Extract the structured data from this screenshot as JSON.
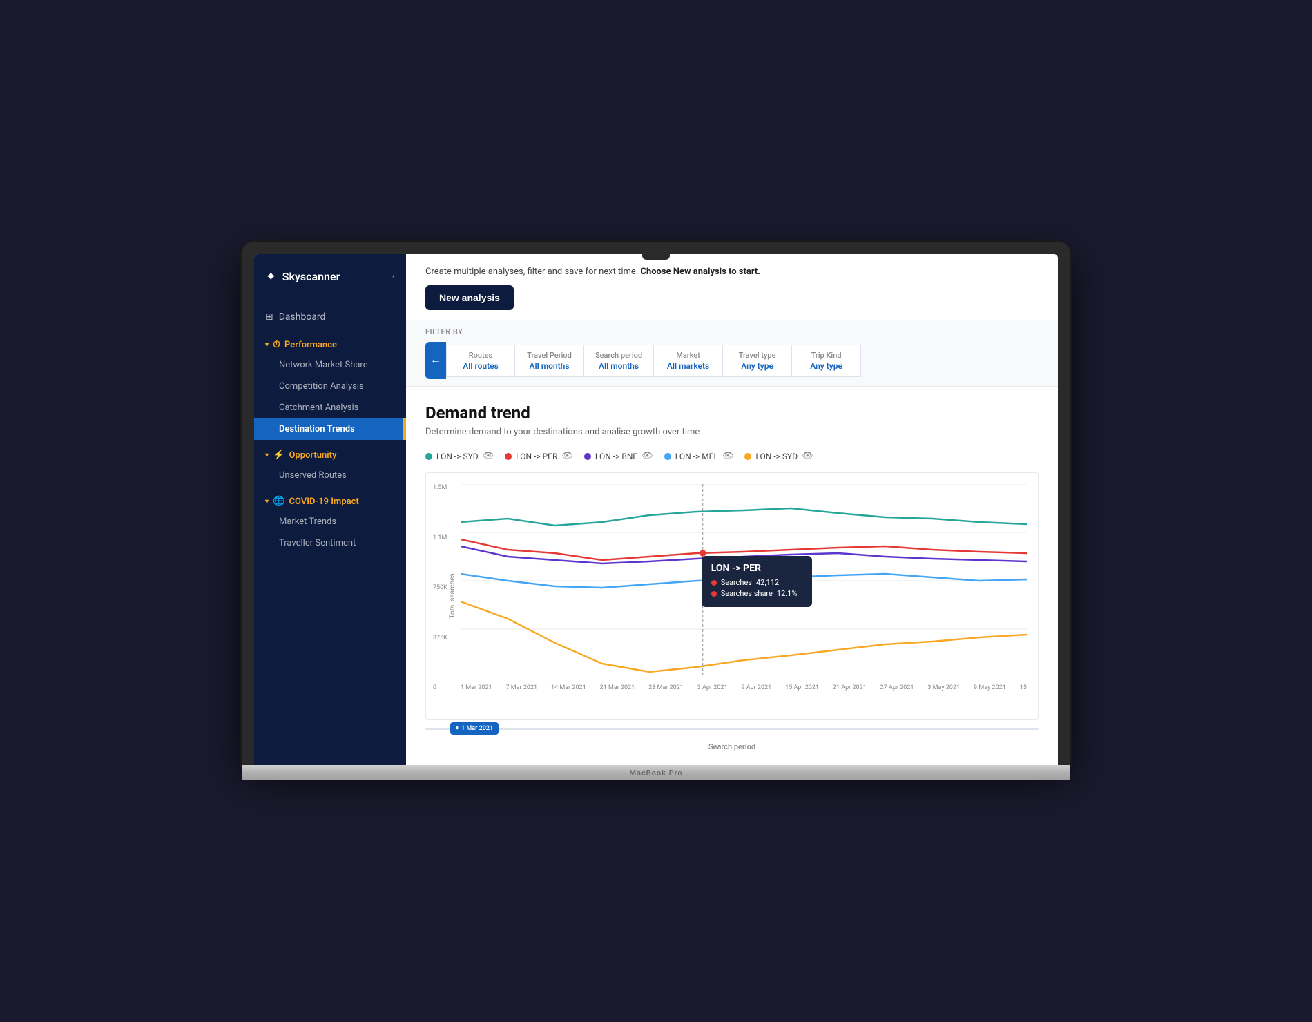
{
  "app": {
    "name": "Skyscanner",
    "logo_symbol": "✦"
  },
  "sidebar": {
    "collapse_label": "‹",
    "dashboard_label": "Dashboard",
    "dashboard_icon": "⊞",
    "sections": [
      {
        "id": "performance",
        "label": "Performance",
        "icon": "⏱",
        "expanded": true,
        "items": [
          {
            "id": "network-market-share",
            "label": "Network Market Share",
            "active": false
          },
          {
            "id": "competition-analysis",
            "label": "Competition Analysis",
            "active": false
          },
          {
            "id": "catchment-analysis",
            "label": "Catchment Analysis",
            "active": false
          },
          {
            "id": "destination-trends",
            "label": "Destination Trends",
            "active": true
          }
        ]
      },
      {
        "id": "opportunity",
        "label": "Opportunity",
        "icon": "⚡",
        "expanded": true,
        "items": [
          {
            "id": "unserved-routes",
            "label": "Unserved Routes",
            "active": false
          }
        ]
      },
      {
        "id": "covid-impact",
        "label": "COVID-19 Impact",
        "icon": "🌐",
        "expanded": true,
        "items": [
          {
            "id": "market-trends",
            "label": "Market Trends",
            "active": false
          },
          {
            "id": "traveller-sentiment",
            "label": "Traveller Sentiment",
            "active": false
          }
        ]
      }
    ]
  },
  "header": {
    "intro_text": "Create multiple analyses, filter and save for next time.",
    "intro_bold": "Choose New analysis to start.",
    "new_analysis_label": "New analysis"
  },
  "filter": {
    "label": "Filter by",
    "back_icon": "←",
    "tabs": [
      {
        "id": "routes",
        "label": "Routes",
        "value": "All routes"
      },
      {
        "id": "travel-period",
        "label": "Travel Period",
        "value": "All months"
      },
      {
        "id": "search-period",
        "label": "Search period",
        "value": "All months"
      },
      {
        "id": "market",
        "label": "Market",
        "value": "All markets"
      },
      {
        "id": "travel-type",
        "label": "Travel type",
        "value": "Any type"
      },
      {
        "id": "trip-kind",
        "label": "Trip Kind",
        "value": "Any type"
      }
    ]
  },
  "chart": {
    "title": "Demand trend",
    "subtitle": "Determine demand to your destinations and analise growth over time",
    "y_label": "Total searches",
    "x_label": "Search period",
    "y_ticks": [
      "1.5M",
      "1.1M",
      "750K",
      "375K",
      "0"
    ],
    "x_ticks": [
      "1 Mar 2021",
      "7 Mar 2021",
      "14 Mar 2021",
      "21 Mar 2021",
      "28 Mar 2021",
      "3 Apr 2021",
      "9 Apr 2021",
      "15 Apr 2021",
      "21 Apr 2021",
      "27 Apr 2021",
      "3 May 2021",
      "9 May 2021",
      "15"
    ],
    "legend": [
      {
        "id": "lon-syd-1",
        "label": "LON -> SYD",
        "color": "#26a69a"
      },
      {
        "id": "lon-per",
        "label": "LON -> PER",
        "color": "#e53935"
      },
      {
        "id": "lon-bne",
        "label": "LON -> BNE",
        "color": "#5c35cc"
      },
      {
        "id": "lon-mel",
        "label": "LON -> MEL",
        "color": "#42a5f5"
      },
      {
        "id": "lon-syd-2",
        "label": "LON -> SYD",
        "color": "#f9a825"
      }
    ],
    "tooltip": {
      "title": "LON -> PER",
      "searches_label": "Searches",
      "searches_value": "42,112",
      "share_label": "Searches share",
      "share_value": "12.1%",
      "color": "#e53935"
    },
    "slider": {
      "date_label": "1 Mar 2021"
    }
  },
  "macbook_label": "MacBook Pro"
}
